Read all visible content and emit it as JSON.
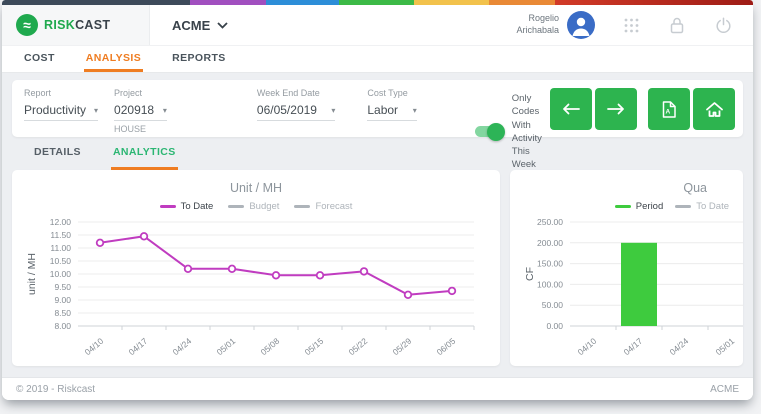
{
  "header": {
    "brand": {
      "glyph": "≈",
      "risk": "RISK",
      "cast": "CAST"
    },
    "company": "ACME",
    "user": {
      "line1": "Rogelio",
      "line2": "Arichabala"
    }
  },
  "nav": {
    "tabs": [
      {
        "label": "COST"
      },
      {
        "label": "ANALYSIS",
        "active": true
      },
      {
        "label": "REPORTS"
      }
    ]
  },
  "filters": {
    "report": {
      "label": "Report",
      "value": "Productivity"
    },
    "project": {
      "label": "Project",
      "value": "020918",
      "sub": "HOUSE"
    },
    "week_end_date": {
      "label": "Week End Date",
      "value": "06/05/2019"
    },
    "cost_type": {
      "label": "Cost Type",
      "value": "Labor"
    },
    "toggle": {
      "line1": "Only Codes",
      "line2": "With Activity",
      "line3": "This Week",
      "on": true
    },
    "caret": "▾"
  },
  "toolbar": {
    "buttons": [
      {
        "icon": "arrow-left"
      },
      {
        "icon": "arrow-right"
      },
      {
        "icon": "file-export"
      },
      {
        "icon": "home"
      }
    ]
  },
  "subnav": {
    "tabs": [
      {
        "label": "DETAILS"
      },
      {
        "label": "ANALYTICS",
        "active": true
      }
    ]
  },
  "chart_data": [
    {
      "type": "line",
      "title": "Unit / MH",
      "ylabel": "unit / MH",
      "categories": [
        "04/10",
        "04/17",
        "04/24",
        "05/01",
        "05/08",
        "05/15",
        "05/22",
        "05/29",
        "06/05"
      ],
      "series": [
        {
          "name": "To Date",
          "color": "#c03cc0",
          "hidden": false,
          "values": [
            11.2,
            11.45,
            10.2,
            10.2,
            9.95,
            9.95,
            10.1,
            9.2,
            9.35
          ]
        },
        {
          "name": "Budget",
          "color": "#aeb4ba",
          "hidden": true,
          "values": []
        },
        {
          "name": "Forecast",
          "color": "#aeb4ba",
          "hidden": true,
          "values": []
        }
      ],
      "ylim": [
        8,
        12
      ],
      "ytick_step": 0.5,
      "grid": true,
      "legend_position": "top-center"
    },
    {
      "type": "bar",
      "title": "Qua",
      "title_truncated": true,
      "ylabel": "CF",
      "categories": [
        "04/10",
        "04/17",
        "04/24",
        "05/01"
      ],
      "series": [
        {
          "name": "Period",
          "color": "#3ecb3e",
          "hidden": false,
          "values": [
            0,
            200,
            0,
            0
          ]
        },
        {
          "name": "To Date",
          "color": "#aeb4ba",
          "hidden": true,
          "values": []
        }
      ],
      "ylim": [
        0,
        250
      ],
      "ytick_step": 50,
      "grid": true,
      "legend_position": "top-right"
    }
  ],
  "footer": {
    "copyright": "© 2019 - Riskcast",
    "company": "ACME"
  },
  "colors": {
    "accent_orange": "#ef7d22",
    "accent_green": "#2bb673",
    "button_green": "#2db44f",
    "toggle_green": "#2db457",
    "line_magenta": "#c03cc0",
    "bar_green": "#3ecb3e",
    "avatar_blue": "#3a6cc6",
    "top_strip": [
      {
        "color": "#3d4a5a",
        "width": 25
      },
      {
        "color": "#a14fbf",
        "width": 10.1
      },
      {
        "color": "#2d8ed8",
        "width": 9.8
      },
      {
        "color": "#3cba47",
        "width": 9.9
      },
      {
        "color": "#f2c24c",
        "width": 10.0
      },
      {
        "color": "#e98936",
        "width": 8.8
      },
      {
        "color": "#d23b28",
        "color2": "#9e1c16",
        "width": 26.4
      }
    ]
  }
}
